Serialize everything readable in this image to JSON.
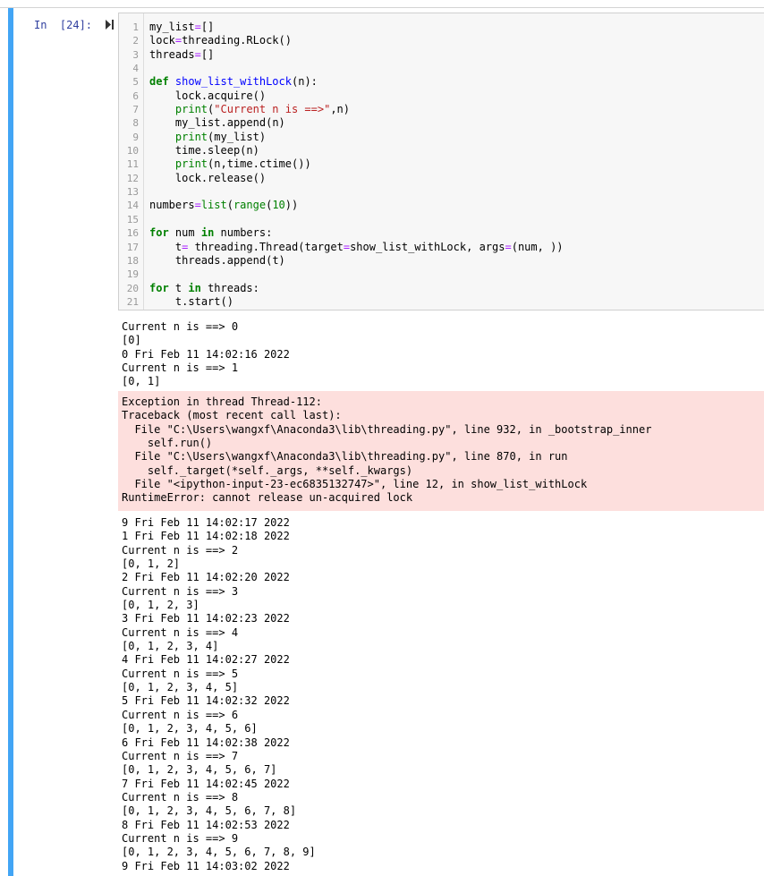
{
  "cell": {
    "prompt": "In  [24]:"
  },
  "code": {
    "lines": [
      {
        "n": "1",
        "t": "my_list=[]"
      },
      {
        "n": "2",
        "t": "lock=threading.RLock()"
      },
      {
        "n": "3",
        "t": "threads=[]"
      },
      {
        "n": "4",
        "t": ""
      },
      {
        "n": "5",
        "t": "def show_list_withLock(n):"
      },
      {
        "n": "6",
        "t": "    lock.acquire()"
      },
      {
        "n": "7",
        "t": "    print(\"Current n is ==>\",n)"
      },
      {
        "n": "8",
        "t": "    my_list.append(n)"
      },
      {
        "n": "9",
        "t": "    print(my_list)"
      },
      {
        "n": "10",
        "t": "    time.sleep(n)"
      },
      {
        "n": "11",
        "t": "    print(n,time.ctime())"
      },
      {
        "n": "12",
        "t": "    lock.release()"
      },
      {
        "n": "13",
        "t": ""
      },
      {
        "n": "14",
        "t": "numbers=list(range(10))"
      },
      {
        "n": "15",
        "t": ""
      },
      {
        "n": "16",
        "t": "for num in numbers:"
      },
      {
        "n": "17",
        "t": "    t= threading.Thread(target=show_list_withLock, args=(num, ))"
      },
      {
        "n": "18",
        "t": "    threads.append(t)"
      },
      {
        "n": "19",
        "t": ""
      },
      {
        "n": "20",
        "t": "for t in threads:"
      },
      {
        "n": "21",
        "t": "    t.start()"
      }
    ]
  },
  "output_before": [
    "Current n is ==> 0",
    "[0]",
    "0 Fri Feb 11 14:02:16 2022",
    "Current n is ==> 1",
    "[0, 1]"
  ],
  "stderr": [
    "Exception in thread Thread-112:",
    "Traceback (most recent call last):",
    "  File \"C:\\Users\\wangxf\\Anaconda3\\lib\\threading.py\", line 932, in _bootstrap_inner",
    "    self.run()",
    "  File \"C:\\Users\\wangxf\\Anaconda3\\lib\\threading.py\", line 870, in run",
    "    self._target(*self._args, **self._kwargs)",
    "  File \"<ipython-input-23-ec6835132747>\", line 12, in show_list_withLock",
    "RuntimeError: cannot release un-acquired lock"
  ],
  "output_after": [
    "9 Fri Feb 11 14:02:17 2022",
    "1 Fri Feb 11 14:02:18 2022",
    "Current n is ==> 2",
    "[0, 1, 2]",
    "2 Fri Feb 11 14:02:20 2022",
    "Current n is ==> 3",
    "[0, 1, 2, 3]",
    "3 Fri Feb 11 14:02:23 2022",
    "Current n is ==> 4",
    "[0, 1, 2, 3, 4]",
    "4 Fri Feb 11 14:02:27 2022",
    "Current n is ==> 5",
    "[0, 1, 2, 3, 4, 5]",
    "5 Fri Feb 11 14:02:32 2022",
    "Current n is ==> 6",
    "[0, 1, 2, 3, 4, 5, 6]",
    "6 Fri Feb 11 14:02:38 2022",
    "Current n is ==> 7",
    "[0, 1, 2, 3, 4, 5, 6, 7]",
    "7 Fri Feb 11 14:02:45 2022",
    "Current n is ==> 8",
    "[0, 1, 2, 3, 4, 5, 6, 7, 8]",
    "8 Fri Feb 11 14:02:53 2022",
    "Current n is ==> 9",
    "[0, 1, 2, 3, 4, 5, 6, 7, 8, 9]",
    "9 Fri Feb 11 14:03:02 2022"
  ],
  "icons": {
    "run": "play-step-icon"
  },
  "colors": {
    "cell_selected_bar": "#42a5f5",
    "prompt": "#303f9f",
    "editor_bg": "#f7f7f7",
    "stderr_bg": "#fddfdd",
    "keyword": "#008000",
    "string": "#ba2121",
    "operator": "#aa22ff",
    "def_name": "#0000ff"
  }
}
